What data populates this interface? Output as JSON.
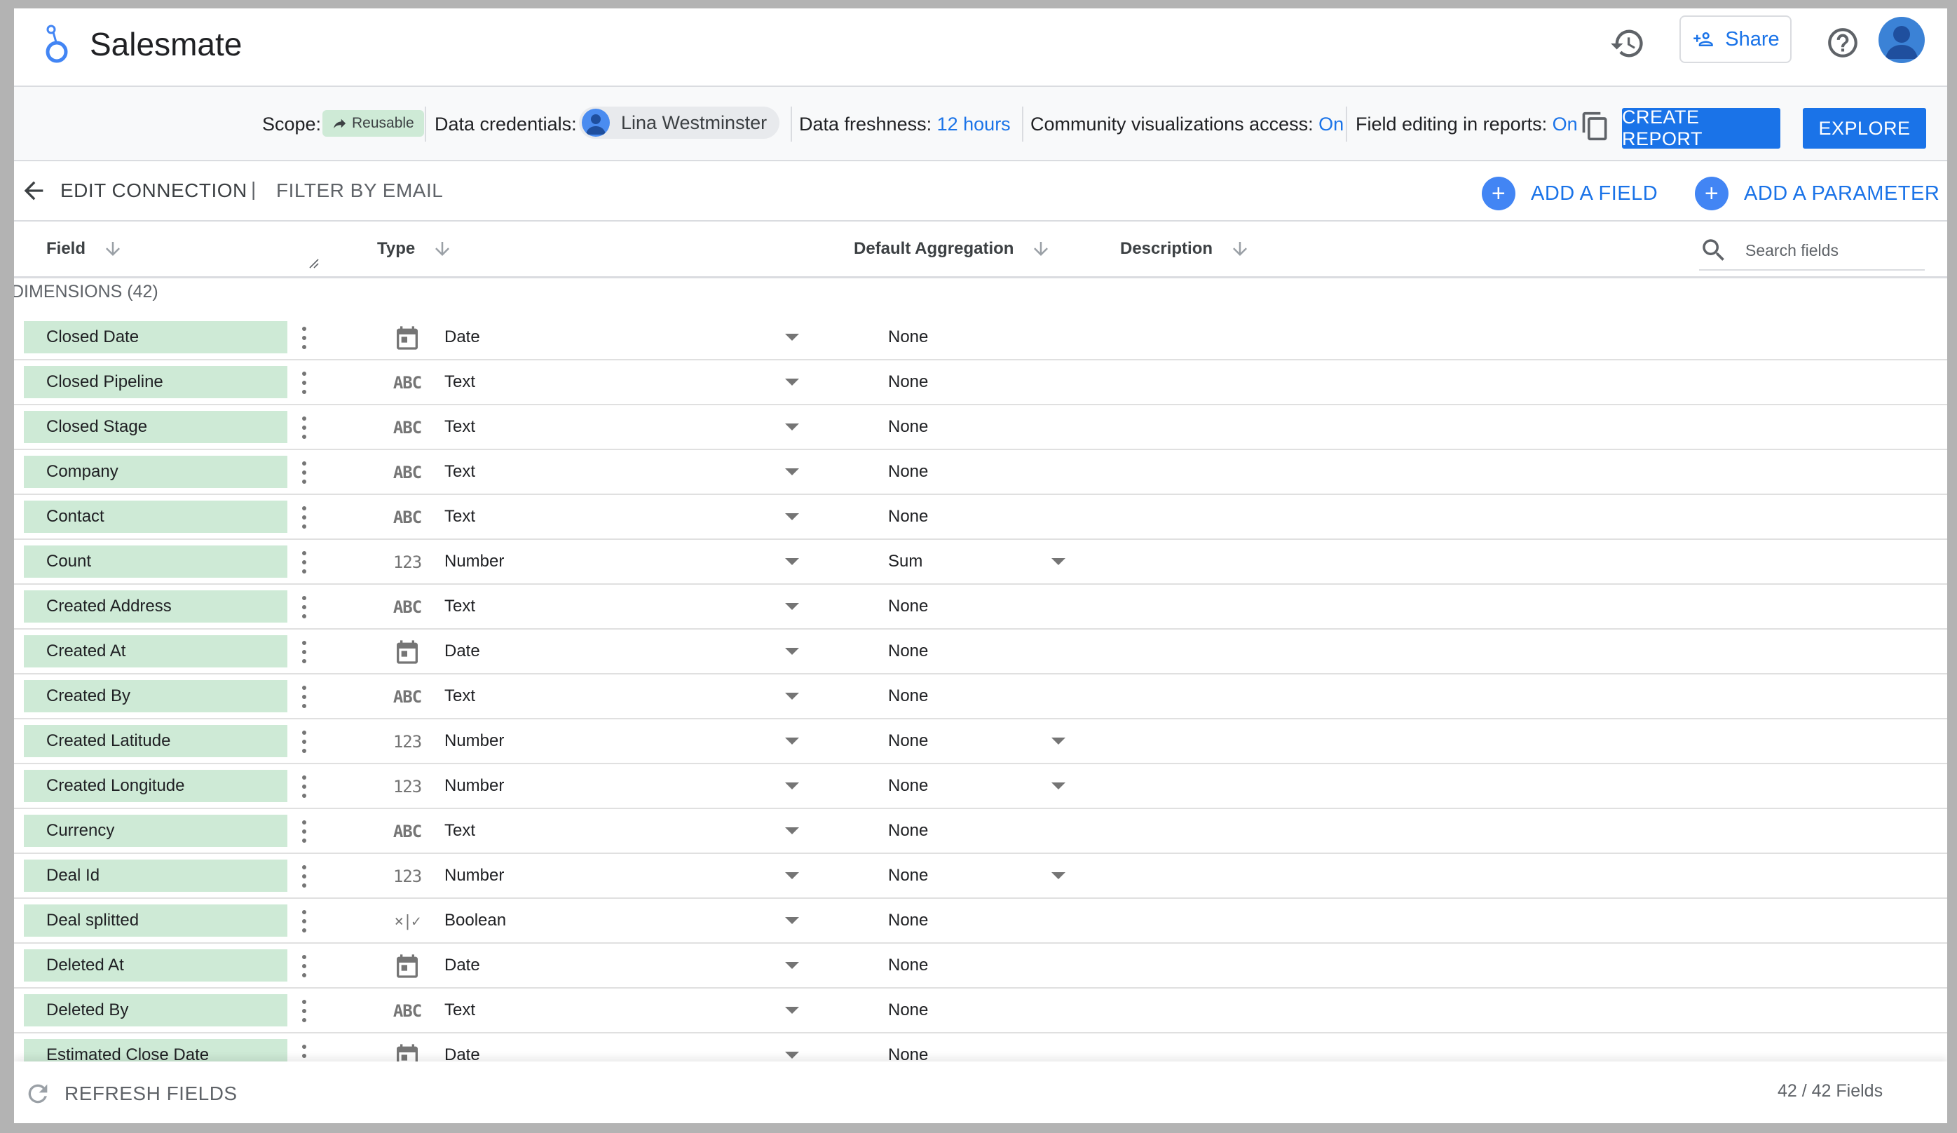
{
  "header": {
    "app_title": "Salesmate",
    "share_label": "Share"
  },
  "infobar": {
    "scope_label": "Scope:",
    "scope_value": "Reusable",
    "credentials_label": "Data credentials:",
    "credentials_user": "Lina Westminster",
    "freshness_label": "Data freshness:",
    "freshness_value": "12 hours",
    "community_label": "Community visualizations access:",
    "community_value": "On",
    "field_editing_label": "Field editing in reports:",
    "field_editing_value": "On",
    "create_report_label": "CREATE REPORT",
    "explore_label": "EXPLORE"
  },
  "toolbar": {
    "edit_connection_label": "EDIT CONNECTION",
    "separator": "|",
    "filter_label": "FILTER BY EMAIL",
    "add_field_label": "ADD A FIELD",
    "add_parameter_label": "ADD A PARAMETER"
  },
  "columns": {
    "field": "Field",
    "type": "Type",
    "aggregation": "Default Aggregation",
    "description": "Description",
    "search_placeholder": "Search fields"
  },
  "dimensions": {
    "title": "DIMENSIONS (42)",
    "rows": [
      {
        "name": "Closed Date",
        "type": "Date",
        "type_icon": "calendar-icon",
        "aggregation": "None",
        "agg_dropdown": false
      },
      {
        "name": "Closed Pipeline",
        "type": "Text",
        "type_icon": "abc-icon",
        "aggregation": "None",
        "agg_dropdown": false
      },
      {
        "name": "Closed Stage",
        "type": "Text",
        "type_icon": "abc-icon",
        "aggregation": "None",
        "agg_dropdown": false
      },
      {
        "name": "Company",
        "type": "Text",
        "type_icon": "abc-icon",
        "aggregation": "None",
        "agg_dropdown": false
      },
      {
        "name": "Contact",
        "type": "Text",
        "type_icon": "abc-icon",
        "aggregation": "None",
        "agg_dropdown": false
      },
      {
        "name": "Count",
        "type": "Number",
        "type_icon": "number-icon",
        "aggregation": "Sum",
        "agg_dropdown": true
      },
      {
        "name": "Created Address",
        "type": "Text",
        "type_icon": "abc-icon",
        "aggregation": "None",
        "agg_dropdown": false
      },
      {
        "name": "Created At",
        "type": "Date",
        "type_icon": "calendar-icon",
        "aggregation": "None",
        "agg_dropdown": false
      },
      {
        "name": "Created By",
        "type": "Text",
        "type_icon": "abc-icon",
        "aggregation": "None",
        "agg_dropdown": false
      },
      {
        "name": "Created Latitude",
        "type": "Number",
        "type_icon": "number-icon",
        "aggregation": "None",
        "agg_dropdown": true
      },
      {
        "name": "Created Longitude",
        "type": "Number",
        "type_icon": "number-icon",
        "aggregation": "None",
        "agg_dropdown": true
      },
      {
        "name": "Currency",
        "type": "Text",
        "type_icon": "abc-icon",
        "aggregation": "None",
        "agg_dropdown": false
      },
      {
        "name": "Deal Id",
        "type": "Number",
        "type_icon": "number-icon",
        "aggregation": "None",
        "agg_dropdown": true
      },
      {
        "name": "Deal splitted",
        "type": "Boolean",
        "type_icon": "boolean-icon",
        "aggregation": "None",
        "agg_dropdown": false
      },
      {
        "name": "Deleted At",
        "type": "Date",
        "type_icon": "calendar-icon",
        "aggregation": "None",
        "agg_dropdown": false
      },
      {
        "name": "Deleted By",
        "type": "Text",
        "type_icon": "abc-icon",
        "aggregation": "None",
        "agg_dropdown": false
      },
      {
        "name": "Estimated Close Date",
        "type": "Date",
        "type_icon": "calendar-icon",
        "aggregation": "None",
        "agg_dropdown": false
      }
    ]
  },
  "footer": {
    "refresh_label": "REFRESH FIELDS",
    "count_label": "42 / 42 Fields"
  },
  "colors": {
    "accent": "#1a73e8",
    "field_chip": "#ceead6",
    "divider": "#dadce0"
  },
  "icons": {
    "abc_glyph": "ABC",
    "number_glyph": "123",
    "boolean_glyph": "×|✓"
  }
}
